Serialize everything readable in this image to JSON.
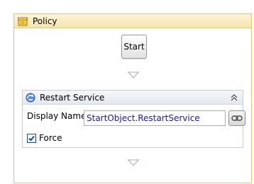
{
  "policy": {
    "title": "Policy",
    "icon": "package-icon"
  },
  "start": {
    "label": "Start"
  },
  "activity": {
    "title": "Restart Service",
    "icon": "service-icon",
    "display_name_label": "Display Name:",
    "display_name_value": "StartObject.RestartService",
    "force_label": "Force",
    "force_checked": true
  },
  "colors": {
    "container_border": "#e3c677",
    "container_header": "#f6e5ad",
    "binding_text": "#1a1aa6"
  }
}
